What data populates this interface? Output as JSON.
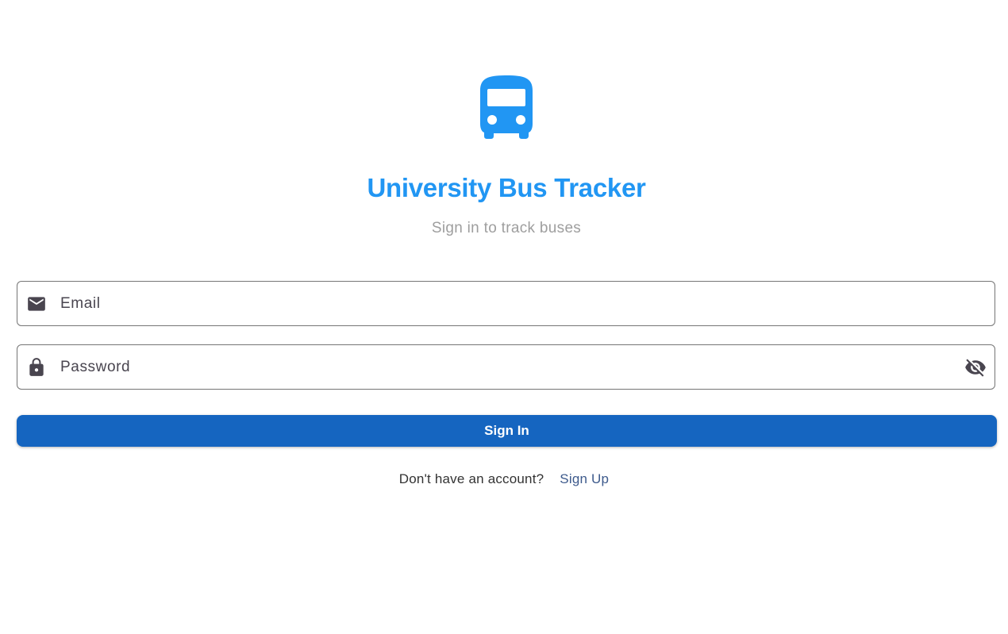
{
  "app": {
    "title": "University Bus Tracker",
    "subtitle": "Sign in to track buses",
    "logo_icon": "bus-icon"
  },
  "form": {
    "email": {
      "placeholder": "Email",
      "value": "",
      "icon": "mail-icon"
    },
    "password": {
      "placeholder": "Password",
      "value": "",
      "icon": "lock-icon",
      "toggle_icon": "visibility-off-icon"
    },
    "submit_label": "Sign In"
  },
  "footer": {
    "prompt": "Don't have an account?",
    "signup_label": "Sign Up"
  },
  "colors": {
    "brand": "#2196f3",
    "button": "#1565c0",
    "link": "#3d5a8c",
    "subtitle": "#9e9e9e",
    "icon": "#49454f"
  }
}
